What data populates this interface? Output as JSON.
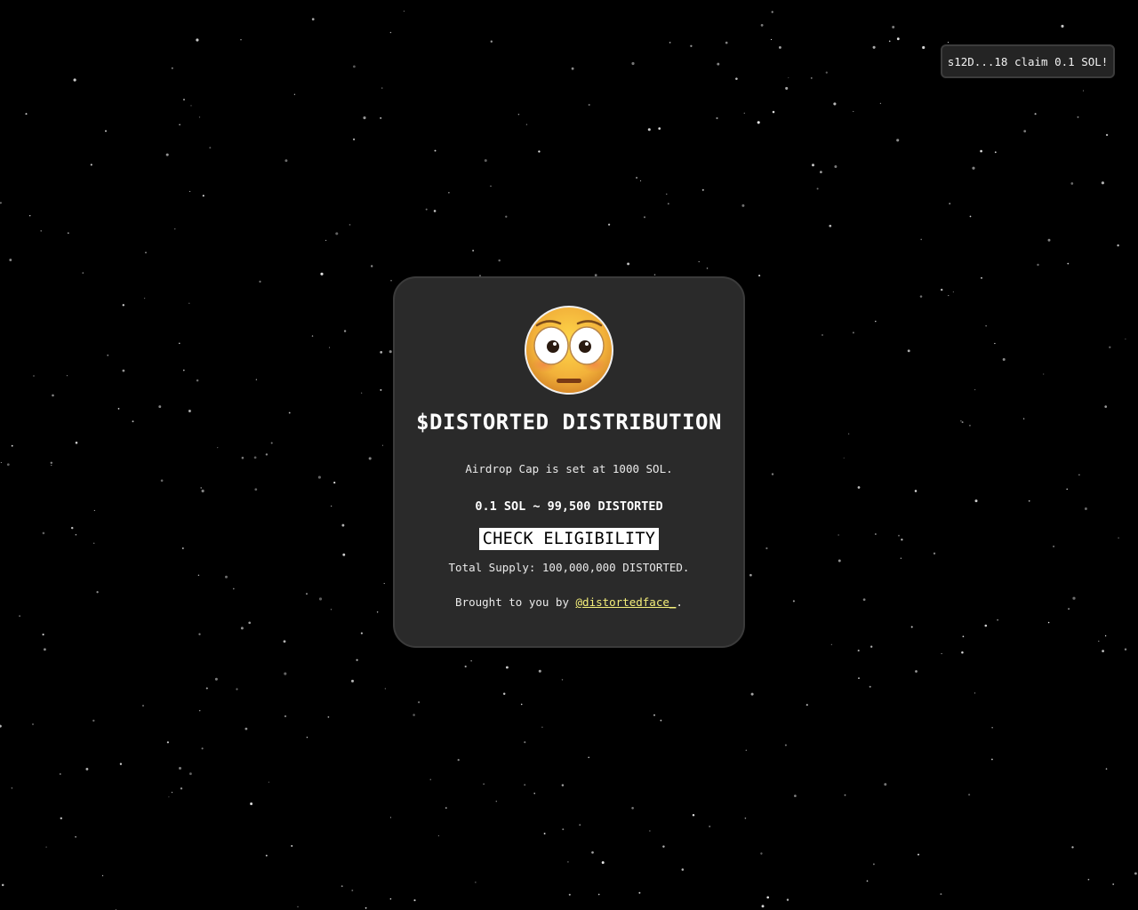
{
  "toast": {
    "message": "s12D...18 claim 0.1 SOL!"
  },
  "card": {
    "avatar_icon": "flushed-face-emoji-icon",
    "title": "$DISTORTED DISTRIBUTION",
    "airdrop_cap": "Airdrop Cap is set at 1000 SOL.",
    "rate": "0.1 SOL ~ 99,500 DISTORTED",
    "check_button_label": "CHECK ELIGIBILITY",
    "total_supply": "Total Supply: 100,000,000 DISTORTED.",
    "credit_prefix": "Brought to you by ",
    "credit_link": "@distortedface_",
    "credit_suffix": "."
  },
  "colors": {
    "background": "#000000",
    "card": "#2a2a2a",
    "link": "#f5ef7a"
  }
}
